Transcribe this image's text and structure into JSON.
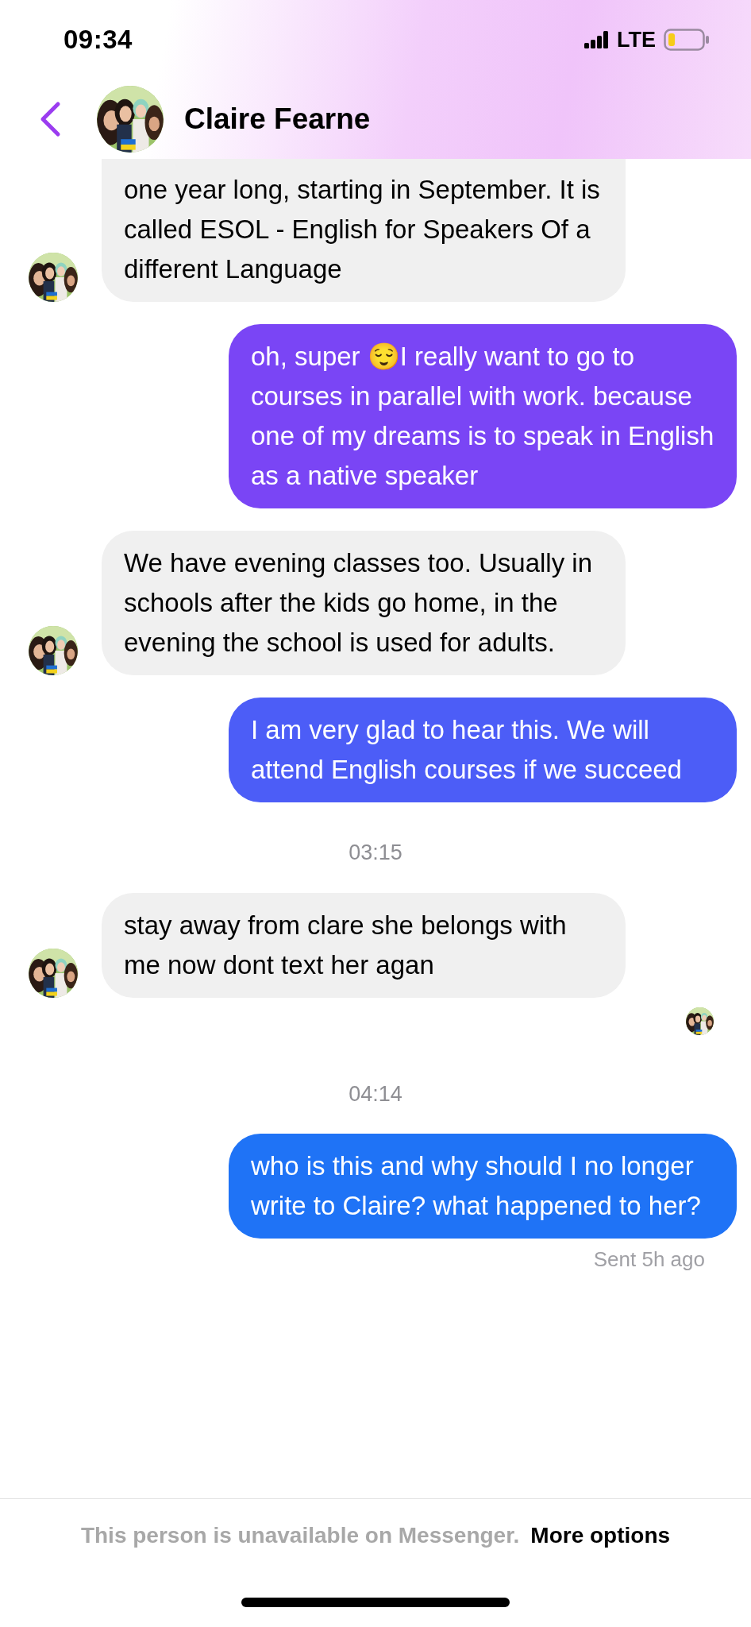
{
  "status_bar": {
    "time": "09:34",
    "network": "LTE"
  },
  "header": {
    "contact_name": "Claire Fearne"
  },
  "messages": [
    {
      "kind": "received",
      "text": "one year long, starting in September. It is called ESOL - English for Speakers Of a different Language"
    },
    {
      "kind": "sent",
      "text": "oh, super 😌I really want to go to courses in parallel with work. because one of my dreams is to speak in English as a native speaker",
      "color": "#7a45f5"
    },
    {
      "kind": "received",
      "text": "We have evening classes too. Usually in schools after the kids go home, in the evening the school is used for adults."
    },
    {
      "kind": "sent",
      "text": "I am very glad to hear this. We will attend English courses if we succeed",
      "color": "#4c5df7"
    },
    {
      "kind": "timestamp",
      "text": "03:15"
    },
    {
      "kind": "received",
      "text": "stay away from clare she belongs with me now dont text her agan"
    },
    {
      "kind": "seen"
    },
    {
      "kind": "timestamp",
      "text": "04:14"
    },
    {
      "kind": "sent",
      "text": "who is this and why should I no longer write to Claire? what happened to her?",
      "color": "#1f73f6"
    },
    {
      "kind": "status",
      "text": "Sent 5h ago"
    }
  ],
  "footer": {
    "notice": "This person is unavailable on Messenger.",
    "action": "More options"
  }
}
